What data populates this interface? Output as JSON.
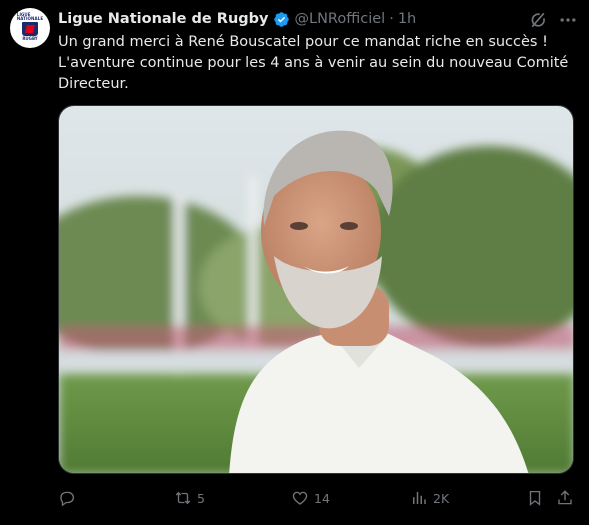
{
  "tweet": {
    "author_name": "Ligue Nationale de Rugby",
    "handle": "@LNRofficiel",
    "separator": "·",
    "time": "1h",
    "avatar_logo": {
      "top": "LIGUE NATIONALE",
      "bottom": "RUGBY"
    },
    "text_lines": [
      "Un grand merci à René Bouscatel pour ce mandat riche en succès !",
      "L'aventure continue pour les 4 ans à venir au sein du nouveau Comité",
      "Directeur."
    ]
  },
  "actions": {
    "reply_count": "",
    "retweet_count": "5",
    "like_count": "14",
    "views_count": "2K"
  },
  "icons": {
    "verified": "verified-badge-icon",
    "grok": "grok-icon",
    "more": "more-icon",
    "reply": "reply-icon",
    "retweet": "retweet-icon",
    "like": "heart-icon",
    "views": "views-icon",
    "bookmark": "bookmark-icon",
    "share": "share-icon"
  },
  "colors": {
    "background": "#000000",
    "text": "#e7e9ea",
    "muted": "#71767b",
    "verified": "#1d9bf0",
    "border": "#2f3336"
  }
}
